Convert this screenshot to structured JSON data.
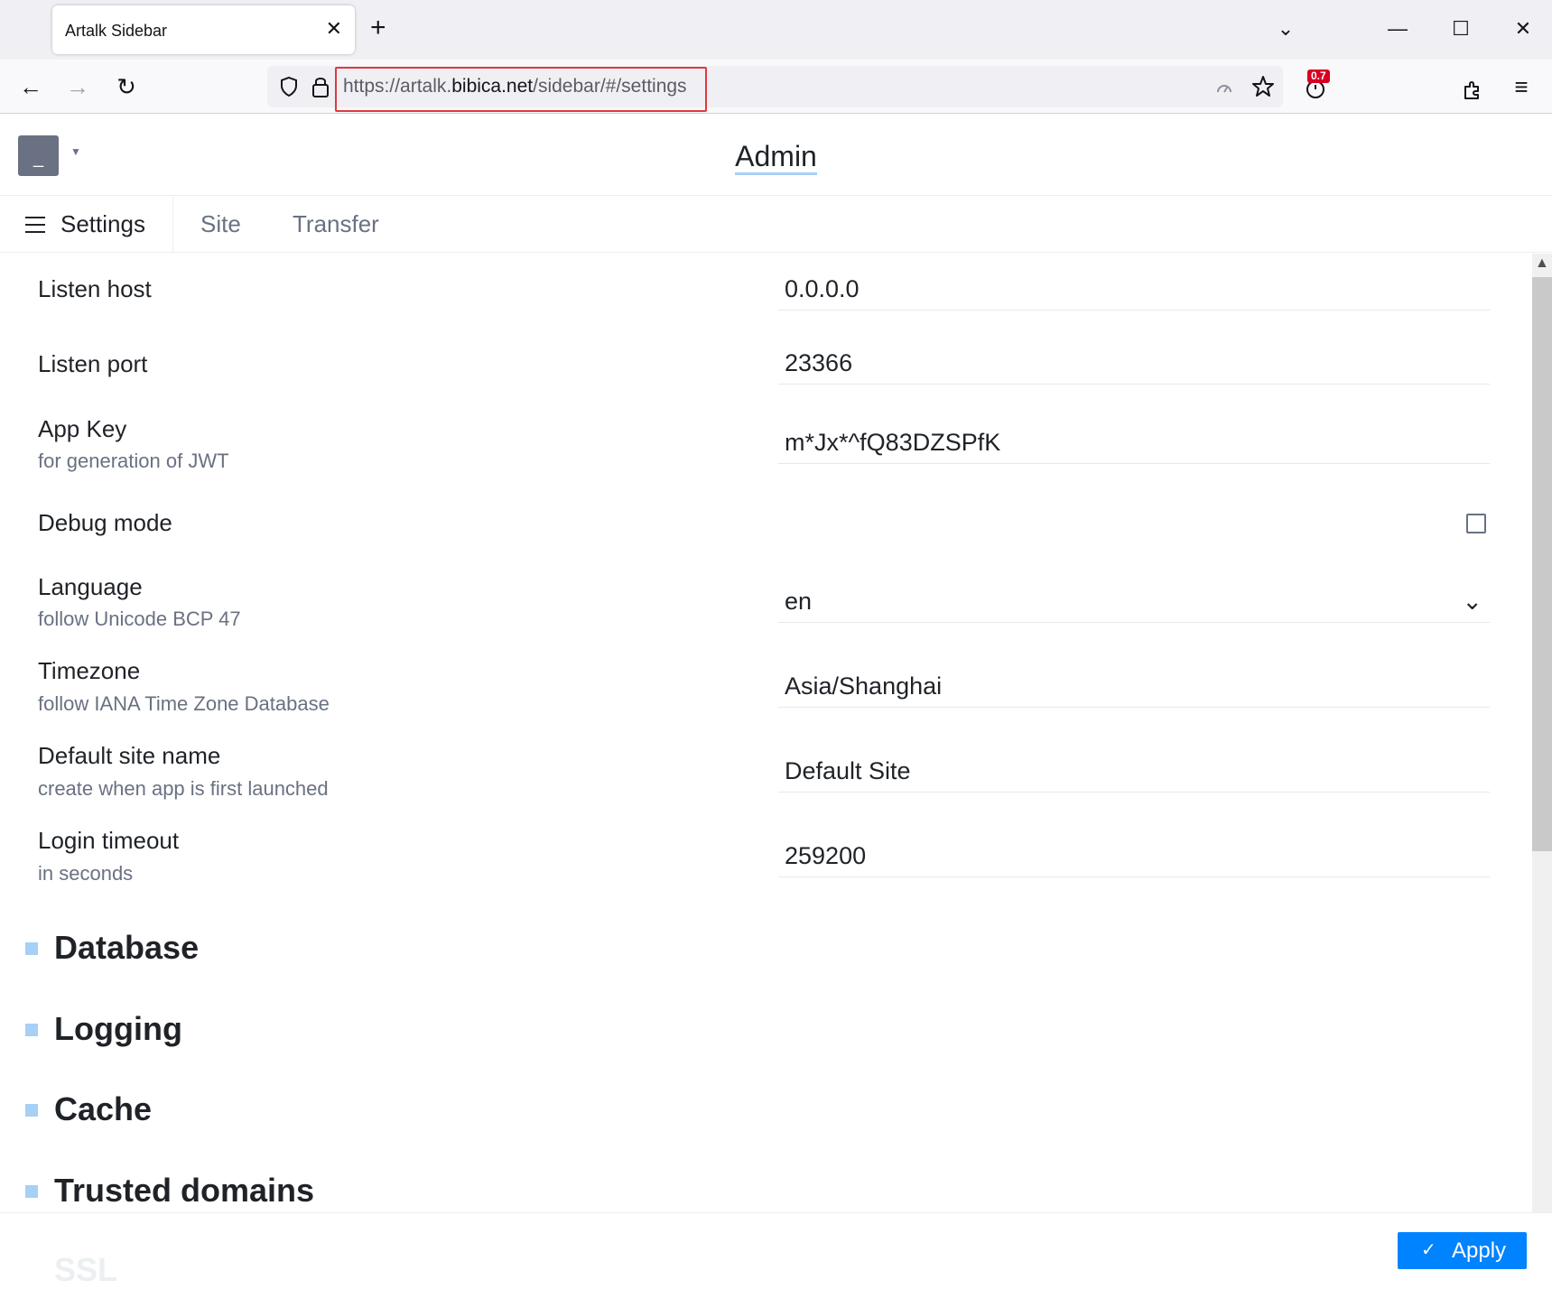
{
  "browser": {
    "tab_title": "Artalk Sidebar",
    "close_glyph": "✕",
    "newtab_glyph": "+",
    "tabs_list_glyph": "⌄",
    "minimize_glyph": "—",
    "maximize_glyph": "☐",
    "window_close_glyph": "✕",
    "back_glyph": "←",
    "forward_glyph": "→",
    "reload_glyph": "↻",
    "url_prefix": "https://artalk.",
    "url_domain": "bibica.net",
    "url_suffix": "/sidebar/#/settings",
    "extension_badge": "0.7",
    "menu_glyph": "≡"
  },
  "header": {
    "avatar_text": "_",
    "avatar_caret": "▼",
    "title": "Admin"
  },
  "tabs": {
    "settings_label": "Settings",
    "site_label": "Site",
    "transfer_label": "Transfer"
  },
  "settings": [
    {
      "label": "Listen host",
      "sub": "",
      "value": "0.0.0.0"
    },
    {
      "label": "Listen port",
      "sub": "",
      "value": "23366"
    },
    {
      "label": "App Key",
      "sub": "for generation of JWT",
      "value": "m*Jx*^fQ83DZSPfK"
    },
    {
      "label": "Debug mode",
      "sub": "",
      "checked": false
    },
    {
      "label": "Language",
      "sub": "follow Unicode BCP 47",
      "value": "en",
      "chevron": "⌄"
    },
    {
      "label": "Timezone",
      "sub": "follow IANA Time Zone Database",
      "value": "Asia/Shanghai"
    },
    {
      "label": "Default site name",
      "sub": "create when app is first launched",
      "value": "Default Site"
    },
    {
      "label": "Login timeout",
      "sub": "in seconds",
      "value": "259200"
    }
  ],
  "sections": [
    "Database",
    "Logging",
    "Cache",
    "Trusted domains"
  ],
  "footer": {
    "next_section_partial": "SSL",
    "apply_check": "✓",
    "apply_label": "Apply"
  },
  "colors": {
    "accent": "#0083ff",
    "section_marker": "#a6d0f5",
    "url_highlight": "#e0393e"
  }
}
